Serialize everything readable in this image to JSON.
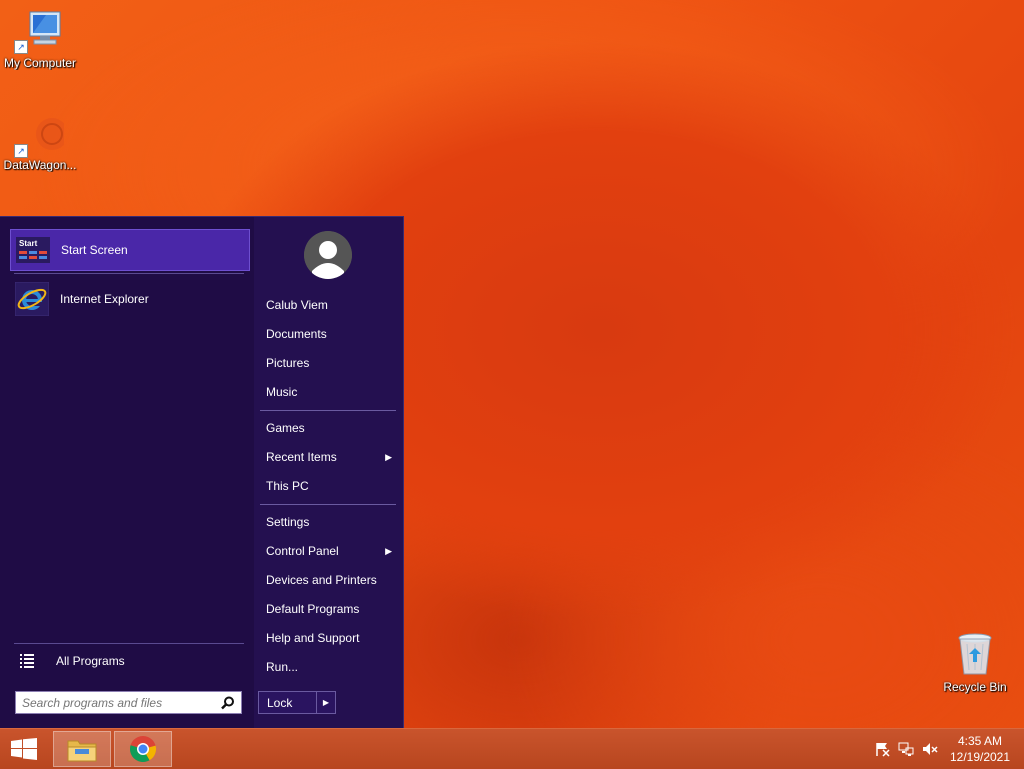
{
  "desktop": {
    "icons": [
      {
        "label": "My Computer",
        "icon": "computer-icon"
      },
      {
        "label": "DataWagon...",
        "icon": "datawagon-icon"
      },
      {
        "label": "Recycle Bin",
        "icon": "recycle-bin-icon"
      }
    ],
    "accent": "#ee5212"
  },
  "start_menu": {
    "pinned": [
      {
        "label": "Start Screen",
        "icon": "start-screen-icon",
        "icon_text": "Start"
      },
      {
        "label": "Internet Explorer",
        "icon": "internet-explorer-icon"
      }
    ],
    "all_programs": "All Programs",
    "search_placeholder": "Search programs and files",
    "right": {
      "user_name": "Calub Viem",
      "group1": [
        "Documents",
        "Pictures",
        "Music"
      ],
      "group2": [
        "Games",
        "Recent Items",
        "This PC"
      ],
      "group3": [
        "Settings",
        "Control Panel",
        "Devices and Printers",
        "Default Programs",
        "Help and Support",
        "Run..."
      ]
    },
    "lock_label": "Lock",
    "colors": {
      "background": "#1f0c45",
      "selected": "#4a27a8"
    }
  },
  "taskbar": {
    "buttons": [
      {
        "icon": "windows-start-icon"
      },
      {
        "icon": "file-explorer-icon"
      },
      {
        "icon": "chrome-icon"
      }
    ],
    "tray": [
      "action-center-flag-icon",
      "network-icon",
      "volume-muted-icon"
    ],
    "time": "4:35 AM",
    "date": "12/19/2021"
  }
}
